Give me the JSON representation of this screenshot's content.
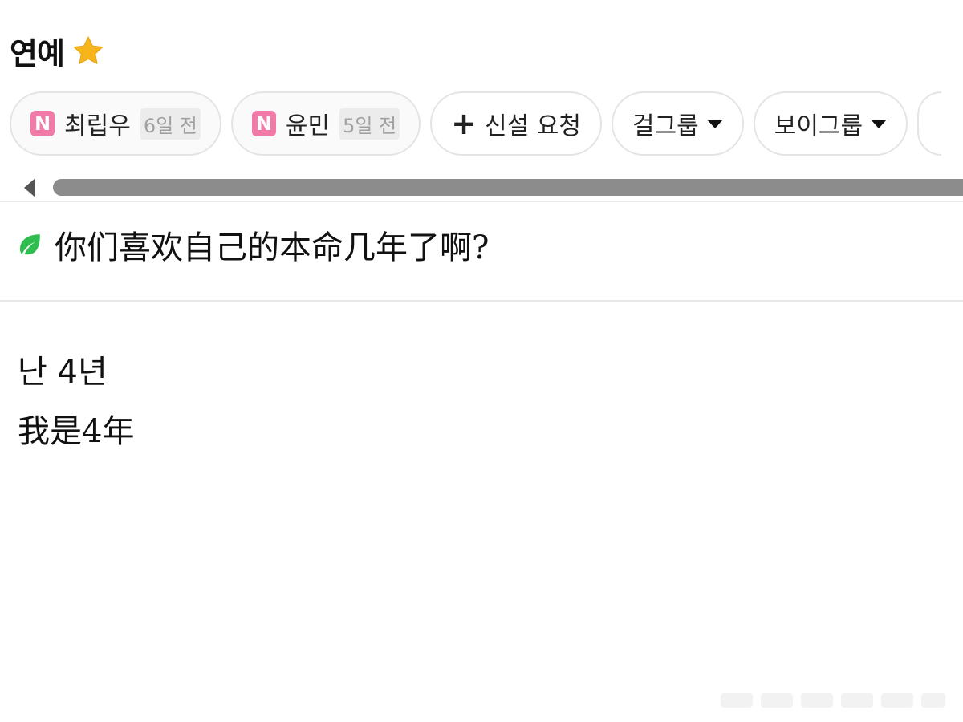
{
  "header": {
    "title": "연예",
    "title_icon": "star-icon"
  },
  "chips": [
    {
      "badge": "N",
      "name": "최립우",
      "time": "6일 전"
    },
    {
      "badge": "N",
      "name": "윤민",
      "time": "5일 전"
    }
  ],
  "request_chip": {
    "icon": "plus-icon",
    "label": "신설 요청"
  },
  "dropdown_chips": [
    {
      "label": "걸그룹",
      "icon": "caret-down-icon"
    },
    {
      "label": "보이그룹",
      "icon": "caret-down-icon"
    }
  ],
  "post": {
    "title_icon": "leaf-icon",
    "title": "你们喜欢自己的本命几年了啊?",
    "body": [
      "난 4년",
      "我是4年"
    ]
  },
  "colors": {
    "star": "#f7b51c",
    "badge": "#f27aa8",
    "leaf": "#2ebd4e",
    "scrollbar": "#8c8c8c"
  }
}
